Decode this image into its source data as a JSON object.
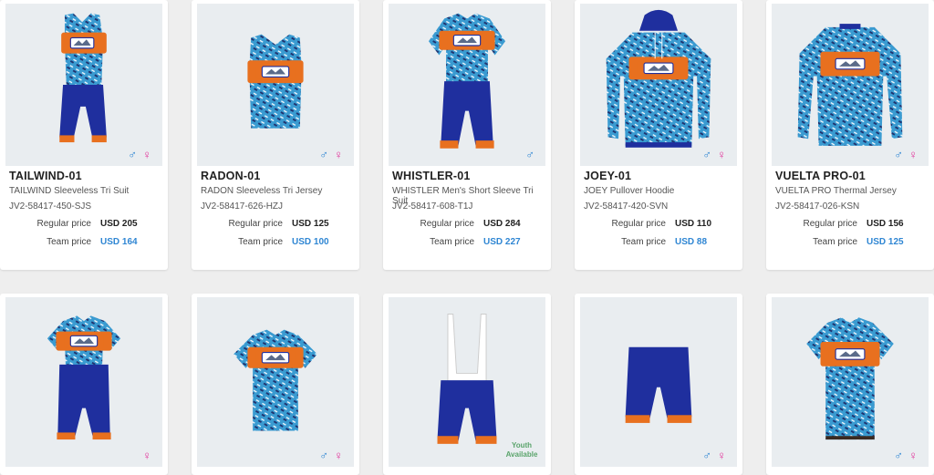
{
  "products": [
    {
      "name": "TAILWIND-01",
      "desc": "TAILWIND Sleeveless Tri Suit",
      "sku": "JV2-58417-450-SJS",
      "regular_label": "Regular price",
      "regular": "USD 205",
      "team_label": "Team price",
      "team": "USD 164",
      "genders": [
        "male",
        "female"
      ],
      "garment": "trisuit-sleeveless"
    },
    {
      "name": "RADON-01",
      "desc": "RADON Sleeveless Tri Jersey",
      "sku": "JV2-58417-626-HZJ",
      "regular_label": "Regular price",
      "regular": "USD 125",
      "team_label": "Team price",
      "team": "USD 100",
      "genders": [
        "male",
        "female"
      ],
      "garment": "tank"
    },
    {
      "name": "WHISTLER-01",
      "desc": "WHISTLER Men's Short Sleeve Tri Suit",
      "sku": "JV2-58417-608-T1J",
      "regular_label": "Regular price",
      "regular": "USD 284",
      "team_label": "Team price",
      "team": "USD 227",
      "genders": [
        "male"
      ],
      "garment": "trisuit-sleeve"
    },
    {
      "name": "JOEY-01",
      "desc": "JOEY Pullover Hoodie",
      "sku": "JV2-58417-420-SVN",
      "regular_label": "Regular price",
      "regular": "USD 110",
      "team_label": "Team price",
      "team": "USD 88",
      "genders": [
        "male",
        "female"
      ],
      "garment": "hoodie"
    },
    {
      "name": "VUELTA PRO-01",
      "desc": "VUELTA PRO Thermal Jersey",
      "sku": "JV2-58417-026-KSN",
      "regular_label": "Regular price",
      "regular": "USD 156",
      "team_label": "Team price",
      "team": "USD 125",
      "genders": [
        "male",
        "female"
      ],
      "garment": "longsleeve"
    }
  ],
  "row2": [
    {
      "genders": [
        "female"
      ],
      "garment": "trisuit-women"
    },
    {
      "genders": [
        "male",
        "female"
      ],
      "garment": "tee"
    },
    {
      "genders": [],
      "garment": "bibshort",
      "badge": "Youth Available"
    },
    {
      "genders": [
        "male",
        "female"
      ],
      "garment": "shorts"
    },
    {
      "genders": [
        "male",
        "female"
      ],
      "garment": "jersey"
    }
  ],
  "gender_symbols": {
    "male": "♂",
    "female": "♀"
  },
  "colors": {
    "accent": "#2f86d3",
    "female": "#e2339a",
    "navy": "#1f2f9e",
    "orange": "#e8701f",
    "pattern": "#3a9bd1"
  }
}
